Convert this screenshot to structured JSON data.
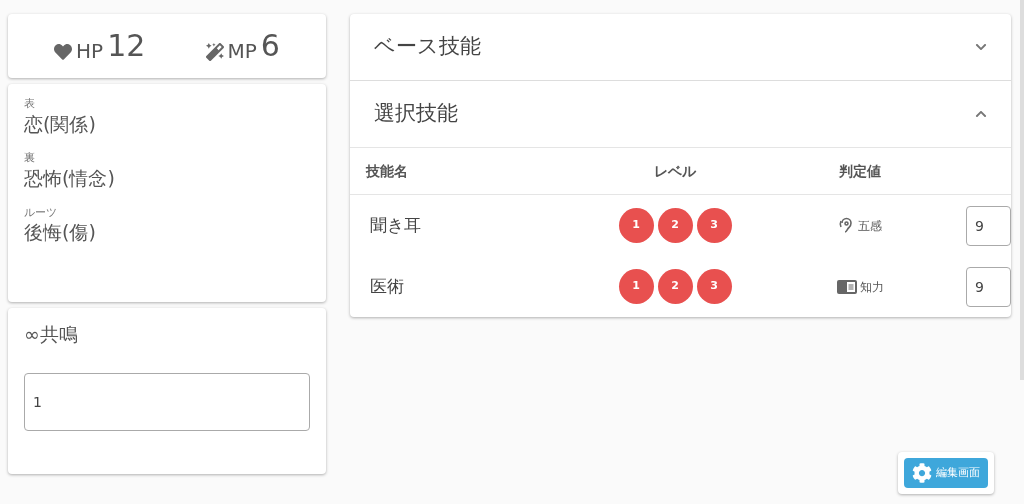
{
  "stats": [
    {
      "kind": "hp",
      "label": "HP",
      "value": "12"
    },
    {
      "kind": "mp",
      "label": "MP",
      "value": "6"
    }
  ],
  "emotions": [
    {
      "label": "表",
      "value": "恋(関係)"
    },
    {
      "label": "裏",
      "value": "恐怖(情念)"
    },
    {
      "label": "ルーツ",
      "value": "後悔(傷)"
    }
  ],
  "resonance": {
    "title": "∞共鳴",
    "value": "1"
  },
  "sections": [
    {
      "title": "ベース技能",
      "expanded": false
    },
    {
      "title": "選択技能",
      "expanded": true
    }
  ],
  "skill_table": {
    "columns": [
      "技能名",
      "レベル",
      "判定値"
    ],
    "rows": [
      {
        "name": "聞き耳",
        "levels": [
          {
            "label": "1",
            "selected": true
          },
          {
            "label": "2",
            "selected": true
          },
          {
            "label": "3",
            "selected": true
          }
        ],
        "attribute": {
          "kind": "ear",
          "label": "五感"
        },
        "value": "9"
      },
      {
        "name": "医術",
        "levels": [
          {
            "label": "1",
            "selected": true
          },
          {
            "label": "2",
            "selected": true
          },
          {
            "label": "3",
            "selected": true
          }
        ],
        "attribute": {
          "kind": "book",
          "label": "知力"
        },
        "value": "9"
      }
    ]
  },
  "edit_button": "編集画面"
}
